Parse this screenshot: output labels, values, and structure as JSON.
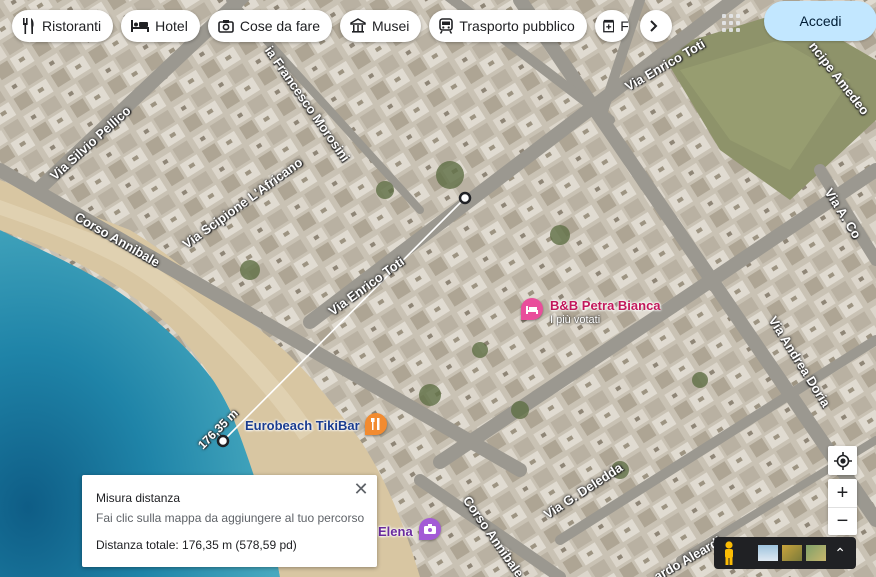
{
  "category_chips": [
    {
      "label": "Ristoranti",
      "icon": "fork-knife-icon"
    },
    {
      "label": "Hotel",
      "icon": "bed-icon"
    },
    {
      "label": "Cose da fare",
      "icon": "camera-icon"
    },
    {
      "label": "Musei",
      "icon": "museum-icon"
    },
    {
      "label": "Trasporto pubblico",
      "icon": "train-icon"
    },
    {
      "label": "F",
      "icon": "pharmacy-icon"
    }
  ],
  "signin_label": "Accedi",
  "road_labels": [
    {
      "text": "Via Silvio Pellico"
    },
    {
      "text": "ia Francesco Morosini"
    },
    {
      "text": "Via Enrico Toti"
    },
    {
      "text": "ncipe Amedeo"
    },
    {
      "text": "Via Scipione L'Africano"
    },
    {
      "text": "Corso Annibale"
    },
    {
      "text": "Via Enrico Toti"
    },
    {
      "text": "Via A. Co"
    },
    {
      "text": "Via Andrea Doria"
    },
    {
      "text": "Via G. Deledda"
    },
    {
      "text": "Corso Annibale"
    },
    {
      "text": "ardo Aleardi"
    }
  ],
  "pois": {
    "bnb": {
      "name": "B&B Petra Bianca",
      "subtitle": "I più votati",
      "color": "#e94e9b"
    },
    "bar": {
      "name": "Eurobeach TikiBar",
      "color": "#f28b30"
    },
    "elena": {
      "name": "Elena",
      "color": "#a35ad6"
    }
  },
  "measure_label": "176,35 m",
  "measure_card": {
    "title": "Misura distanza",
    "hint": "Fai clic sulla mappa da aggiungere al tuo percorso",
    "total": "Distanza totale: 176,35 m (578,59 pd)",
    "close_glyph": "✕"
  },
  "zoom_in": "+",
  "zoom_out": "−",
  "layers_expand": "⌃"
}
